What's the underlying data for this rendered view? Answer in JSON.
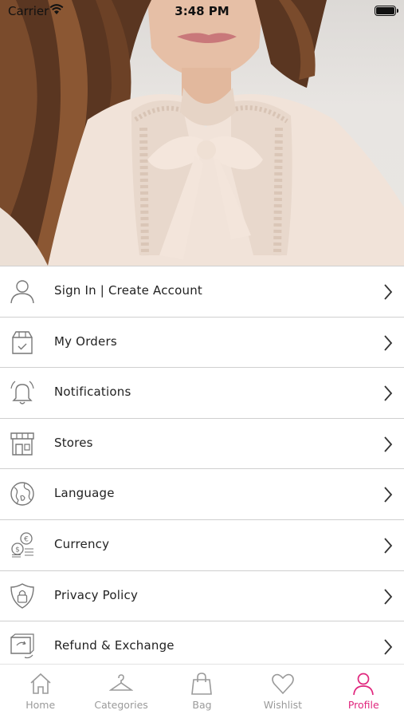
{
  "status_bar": {
    "carrier": "Carrier",
    "time": "3:48 PM",
    "battery_level": 1.0
  },
  "hero": {
    "icon": "model-photo"
  },
  "menu": {
    "items": [
      {
        "label": "Sign In | Create Account",
        "icon": "user-icon"
      },
      {
        "label": "My Orders",
        "icon": "order-box-icon"
      },
      {
        "label": "Notifications",
        "icon": "bell-icon"
      },
      {
        "label": "Stores",
        "icon": "store-icon"
      },
      {
        "label": "Language",
        "icon": "globe-icon"
      },
      {
        "label": "Currency",
        "icon": "currency-coins-icon"
      },
      {
        "label": "Privacy Policy",
        "icon": "shield-lock-icon"
      },
      {
        "label": "Refund & Exchange",
        "icon": "refund-box-icon"
      }
    ]
  },
  "tab_bar": {
    "active_color": "#e0267d",
    "inactive_color": "#9a9a9a",
    "tabs": [
      {
        "label": "Home",
        "icon": "home-icon"
      },
      {
        "label": "Categories",
        "icon": "hanger-icon"
      },
      {
        "label": "Bag",
        "icon": "shopping-bag-icon"
      },
      {
        "label": "Wishlist",
        "icon": "heart-icon"
      },
      {
        "label": "Profile",
        "icon": "profile-icon",
        "active": true
      }
    ]
  }
}
